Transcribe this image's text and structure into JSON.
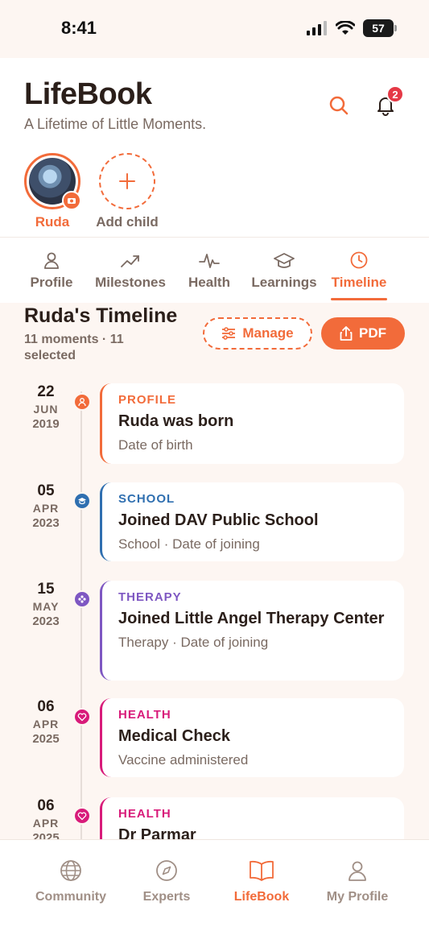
{
  "status_bar": {
    "time": "8:41",
    "battery": "57"
  },
  "header": {
    "title": "LifeBook",
    "subtitle": "A Lifetime of Little Moments.",
    "notification_count": "2"
  },
  "children": {
    "selected_name": "Ruda",
    "add_label": "Add child"
  },
  "tabs": [
    {
      "label": "Profile",
      "icon": "person-icon"
    },
    {
      "label": "Milestones",
      "icon": "trend-icon"
    },
    {
      "label": "Health",
      "icon": "pulse-icon"
    },
    {
      "label": "Learnings",
      "icon": "graduation-cap-icon"
    },
    {
      "label": "Timeline",
      "icon": "clock-icon",
      "active": true
    }
  ],
  "timeline": {
    "title": "Ruda's Timeline",
    "summary": "11 moments · 11 selected",
    "manage_label": "Manage",
    "pdf_label": "PDF",
    "events": [
      {
        "day": "22",
        "month": "JUN",
        "year": "2019",
        "category": "PROFILE",
        "title": "Ruda was born",
        "desc": "Date of birth",
        "color": "#f26b3a",
        "icon": "person-icon"
      },
      {
        "day": "05",
        "month": "APR",
        "year": "2023",
        "category": "SCHOOL",
        "title": "Joined DAV Public School",
        "desc": "School · Date of joining",
        "color": "#2f6fb0",
        "icon": "graduation-cap-icon"
      },
      {
        "day": "15",
        "month": "MAY",
        "year": "2023",
        "category": "THERAPY",
        "title": "Joined Little Angel Therapy Center",
        "desc": "Therapy · Date of joining",
        "color": "#7e57c2",
        "icon": "flower-icon"
      },
      {
        "day": "06",
        "month": "APR",
        "year": "2025",
        "category": "HEALTH",
        "title": "Medical Check",
        "desc": "Vaccine administered",
        "color": "#d81b7a",
        "icon": "heart-icon"
      },
      {
        "day": "06",
        "month": "APR",
        "year": "2025",
        "category": "HEALTH",
        "title": "Dr Parmar",
        "desc": "",
        "color": "#d81b7a",
        "icon": "heart-icon"
      }
    ]
  },
  "bottom_nav": [
    {
      "label": "Community",
      "icon": "globe-icon"
    },
    {
      "label": "Experts",
      "icon": "compass-icon"
    },
    {
      "label": "LifeBook",
      "icon": "book-icon",
      "active": true
    },
    {
      "label": "My Profile",
      "icon": "person-icon"
    }
  ],
  "colors": {
    "accent": "#f26b3a",
    "text": "#2b1f1a",
    "muted": "#7a6a62"
  }
}
